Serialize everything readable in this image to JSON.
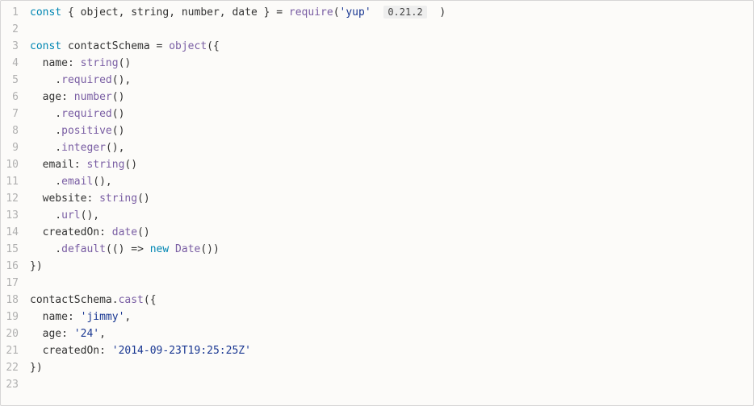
{
  "lineCount": 23,
  "tokens": {
    "l1": {
      "const": "const",
      "destruct": " { object, string, number, date } ",
      "eq": "= ",
      "require": "require",
      "open": "(",
      "pkg": "'yup'",
      "sp": "  ",
      "version": "0.21.2",
      "sp2": "  ",
      "close": ")"
    },
    "l3": {
      "const": "const",
      "name": " contactSchema ",
      "eq": "= ",
      "fn": "object",
      "rest": "({"
    },
    "l4": {
      "indent": "  ",
      "key": "name: ",
      "fn": "string",
      "rest": "()"
    },
    "l5": {
      "indent": "    .",
      "fn": "required",
      "rest": "(),"
    },
    "l6": {
      "indent": "  ",
      "key": "age: ",
      "fn": "number",
      "rest": "()"
    },
    "l7": {
      "indent": "    .",
      "fn": "required",
      "rest": "()"
    },
    "l8": {
      "indent": "    .",
      "fn": "positive",
      "rest": "()"
    },
    "l9": {
      "indent": "    .",
      "fn": "integer",
      "rest": "(),"
    },
    "l10": {
      "indent": "  ",
      "key": "email: ",
      "fn": "string",
      "rest": "()"
    },
    "l11": {
      "indent": "    .",
      "fn": "email",
      "rest": "(),"
    },
    "l12": {
      "indent": "  ",
      "key": "website: ",
      "fn": "string",
      "rest": "()"
    },
    "l13": {
      "indent": "    .",
      "fn": "url",
      "rest": "(),"
    },
    "l14": {
      "indent": "  ",
      "key": "createdOn: ",
      "fn": "date",
      "rest": "()"
    },
    "l15": {
      "indent": "    .",
      "fn": "default",
      "mid": "(() => ",
      "new": "new",
      "sp": " ",
      "cls": "Date",
      "end": "())"
    },
    "l16": {
      "text": "})"
    },
    "l18": {
      "obj": "contactSchema.",
      "fn": "cast",
      "rest": "({"
    },
    "l19": {
      "indent": "  ",
      "key": "name: ",
      "val": "'jimmy'",
      "rest": ","
    },
    "l20": {
      "indent": "  ",
      "key": "age: ",
      "val": "'24'",
      "rest": ","
    },
    "l21": {
      "indent": "  ",
      "key": "createdOn: ",
      "val": "'2014-09-23T19:25:25Z'"
    },
    "l22": {
      "text": "})"
    }
  }
}
